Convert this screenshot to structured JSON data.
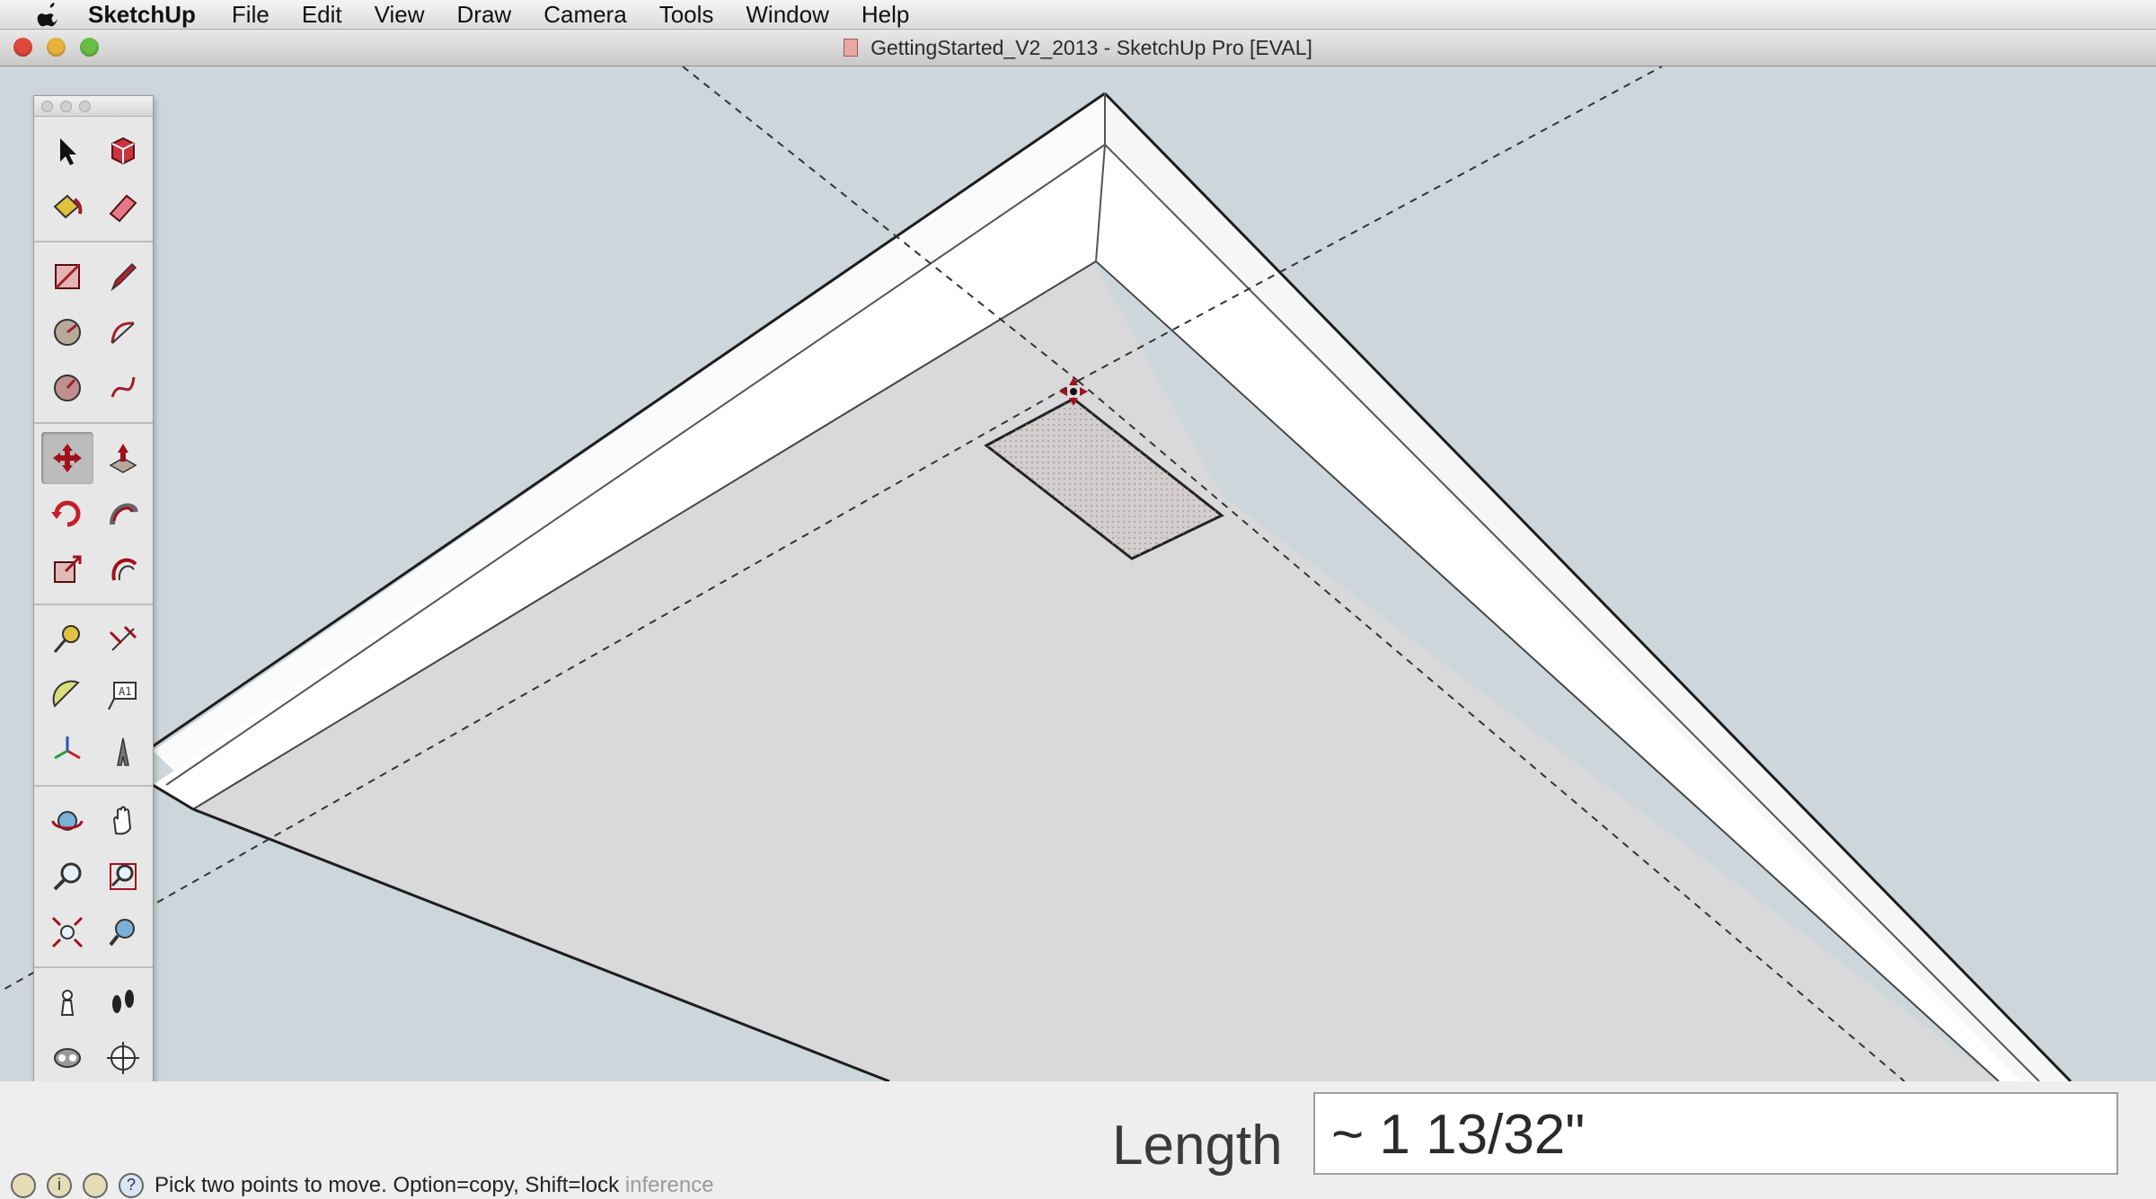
{
  "menubar": {
    "apple_icon": "apple-icon",
    "app_name": "SketchUp",
    "items": [
      "File",
      "Edit",
      "View",
      "Draw",
      "Camera",
      "Tools",
      "Window",
      "Help"
    ]
  },
  "window": {
    "title": "GettingStarted_V2_2013 - SketchUp Pro [EVAL]"
  },
  "palette": {
    "tools": [
      "select-tool-icon",
      "make-component-icon",
      "paint-bucket-icon",
      "eraser-icon",
      "rectangle-icon",
      "line-pencil-icon",
      "circle-icon",
      "arc-icon",
      "polygon-icon",
      "freehand-icon",
      "move-tool-icon",
      "push-pull-icon",
      "rotate-icon",
      "follow-me-icon",
      "scale-icon",
      "offset-icon",
      "tape-measure-icon",
      "dimension-icon",
      "protractor-icon",
      "text-tool-icon",
      "axes-icon",
      "3d-text-icon",
      "orbit-icon",
      "pan-icon",
      "zoom-icon",
      "zoom-window-icon",
      "zoom-extents-icon",
      "previous-view-icon",
      "position-camera-icon",
      "walk-icon",
      "look-around-icon",
      "section-plane-icon"
    ],
    "active_tool": "move-tool-icon"
  },
  "vcb": {
    "label": "Length",
    "value": "~ 1 13/32\""
  },
  "status": {
    "text": "Pick two points to move.  Option=copy, Shift=lock",
    "faded_text": "inference"
  },
  "colors": {
    "sky": "#cdd7db",
    "ground": "#d9d9db",
    "accent_red": "#b3202a"
  }
}
